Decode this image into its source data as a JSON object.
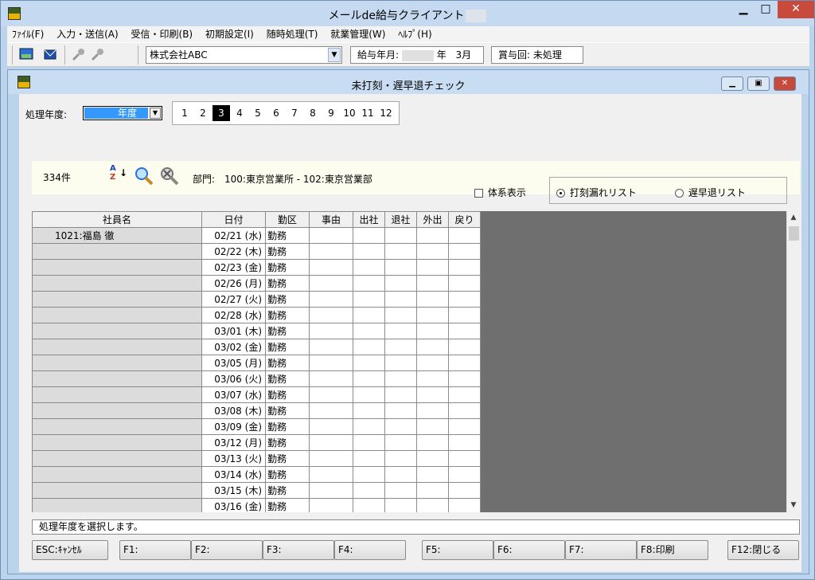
{
  "app": {
    "title": "メールde給与クライアント"
  },
  "menu": [
    "ﾌｧｲﾙ(F)",
    "入力・送信(A)",
    "受信・印刷(B)",
    "初期設定(I)",
    "随時処理(T)",
    "就業管理(W)",
    "ﾍﾙﾌﾟ(H)"
  ],
  "toolbar": {
    "company": "株式会社ABC",
    "pay_label": "給与年月:",
    "pay_year_suffix": "年",
    "pay_month": "3月",
    "bonus_label": "賞与回:",
    "bonus_value": "未処理"
  },
  "window": {
    "title": "未打刻・遅早退チェック"
  },
  "filter": {
    "year_label": "処理年度:",
    "year_value": "年度",
    "months": [
      "1",
      "2",
      "3",
      "4",
      "5",
      "6",
      "7",
      "8",
      "9",
      "10",
      "11",
      "12"
    ],
    "selected_month": "3"
  },
  "info": {
    "count": "334件",
    "dept_label": "部門:",
    "dept_range": "100:東京営業所 - 102:東京営業部"
  },
  "options": {
    "tree_label": "体系表示",
    "radio1": "打刻漏れリスト",
    "radio2": "遅早退リスト"
  },
  "table": {
    "headers": [
      "社員名",
      "日付",
      "勤区",
      "事由",
      "出社",
      "退社",
      "外出",
      "戻り"
    ],
    "rows": [
      {
        "name": "1021:福島 徹",
        "date": "02/21 (水)",
        "kind": "勤務"
      },
      {
        "name": "",
        "date": "02/22 (木)",
        "kind": "勤務"
      },
      {
        "name": "",
        "date": "02/23 (金)",
        "kind": "勤務"
      },
      {
        "name": "",
        "date": "02/26 (月)",
        "kind": "勤務"
      },
      {
        "name": "",
        "date": "02/27 (火)",
        "kind": "勤務"
      },
      {
        "name": "",
        "date": "02/28 (水)",
        "kind": "勤務"
      },
      {
        "name": "",
        "date": "03/01 (木)",
        "kind": "勤務"
      },
      {
        "name": "",
        "date": "03/02 (金)",
        "kind": "勤務"
      },
      {
        "name": "",
        "date": "03/05 (月)",
        "kind": "勤務"
      },
      {
        "name": "",
        "date": "03/06 (火)",
        "kind": "勤務"
      },
      {
        "name": "",
        "date": "03/07 (水)",
        "kind": "勤務"
      },
      {
        "name": "",
        "date": "03/08 (木)",
        "kind": "勤務"
      },
      {
        "name": "",
        "date": "03/09 (金)",
        "kind": "勤務"
      },
      {
        "name": "",
        "date": "03/12 (月)",
        "kind": "勤務"
      },
      {
        "name": "",
        "date": "03/13 (火)",
        "kind": "勤務"
      },
      {
        "name": "",
        "date": "03/14 (水)",
        "kind": "勤務"
      },
      {
        "name": "",
        "date": "03/15 (木)",
        "kind": "勤務"
      },
      {
        "name": "",
        "date": "03/16 (金)",
        "kind": "勤務"
      }
    ]
  },
  "status": "処理年度を選択します。",
  "fkeys": [
    "ESC:ｷｬﾝｾﾙ",
    "F1:",
    "F2:",
    "F3:",
    "F4:",
    "F5:",
    "F6:",
    "F7:",
    "F8:印刷",
    "F12:閉じる"
  ]
}
